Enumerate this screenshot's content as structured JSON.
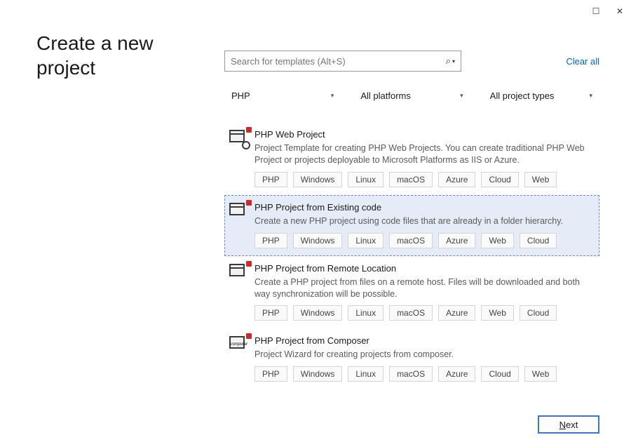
{
  "header": {
    "title": "Create a new project"
  },
  "search": {
    "placeholder": "Search for templates (Alt+S)"
  },
  "clear_all": "Clear all",
  "filters": {
    "language": "PHP",
    "platform": "All platforms",
    "project_type": "All project types"
  },
  "templates": [
    {
      "title": "PHP Web Project",
      "desc": "Project Template for creating PHP Web Projects. You can create traditional PHP Web Project or projects deployable to Microsoft Platforms as IIS or Azure.",
      "tags": [
        "PHP",
        "Windows",
        "Linux",
        "macOS",
        "Azure",
        "Cloud",
        "Web"
      ],
      "icon": "web"
    },
    {
      "title": "PHP Project from Existing code",
      "desc": "Create a new PHP project using code files that are already in a folder hierarchy.",
      "tags": [
        "PHP",
        "Windows",
        "Linux",
        "macOS",
        "Azure",
        "Web",
        "Cloud"
      ],
      "icon": "window",
      "selected": true
    },
    {
      "title": "PHP Project from Remote Location",
      "desc": "Create a PHP project from files on a remote host. Files will be downloaded and both way synchronization will be possible.",
      "tags": [
        "PHP",
        "Windows",
        "Linux",
        "macOS",
        "Azure",
        "Web",
        "Cloud"
      ],
      "icon": "window"
    },
    {
      "title": "PHP Project from Composer",
      "desc": "Project Wizard for creating projects from composer.",
      "tags": [
        "PHP",
        "Windows",
        "Linux",
        "macOS",
        "Azure",
        "Cloud",
        "Web"
      ],
      "icon": "composer"
    }
  ],
  "footer": {
    "next": "ext"
  }
}
